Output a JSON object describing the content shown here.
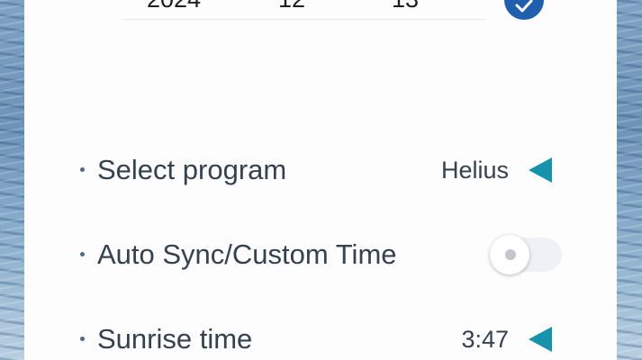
{
  "date_picker": {
    "year": "2024",
    "month": "12",
    "day": "13"
  },
  "settings": {
    "program": {
      "label": "Select program",
      "value": "Helius"
    },
    "auto_sync": {
      "label": "Auto Sync/Custom Time",
      "enabled": false
    },
    "sunrise": {
      "label": "Sunrise time",
      "value": "3:47"
    }
  },
  "icons": {
    "confirm": "check-circle-icon",
    "arrow": "triangle-left-icon"
  },
  "colors": {
    "accent": "#1693ab",
    "confirm": "#1f5fae",
    "text": "#34414f"
  }
}
